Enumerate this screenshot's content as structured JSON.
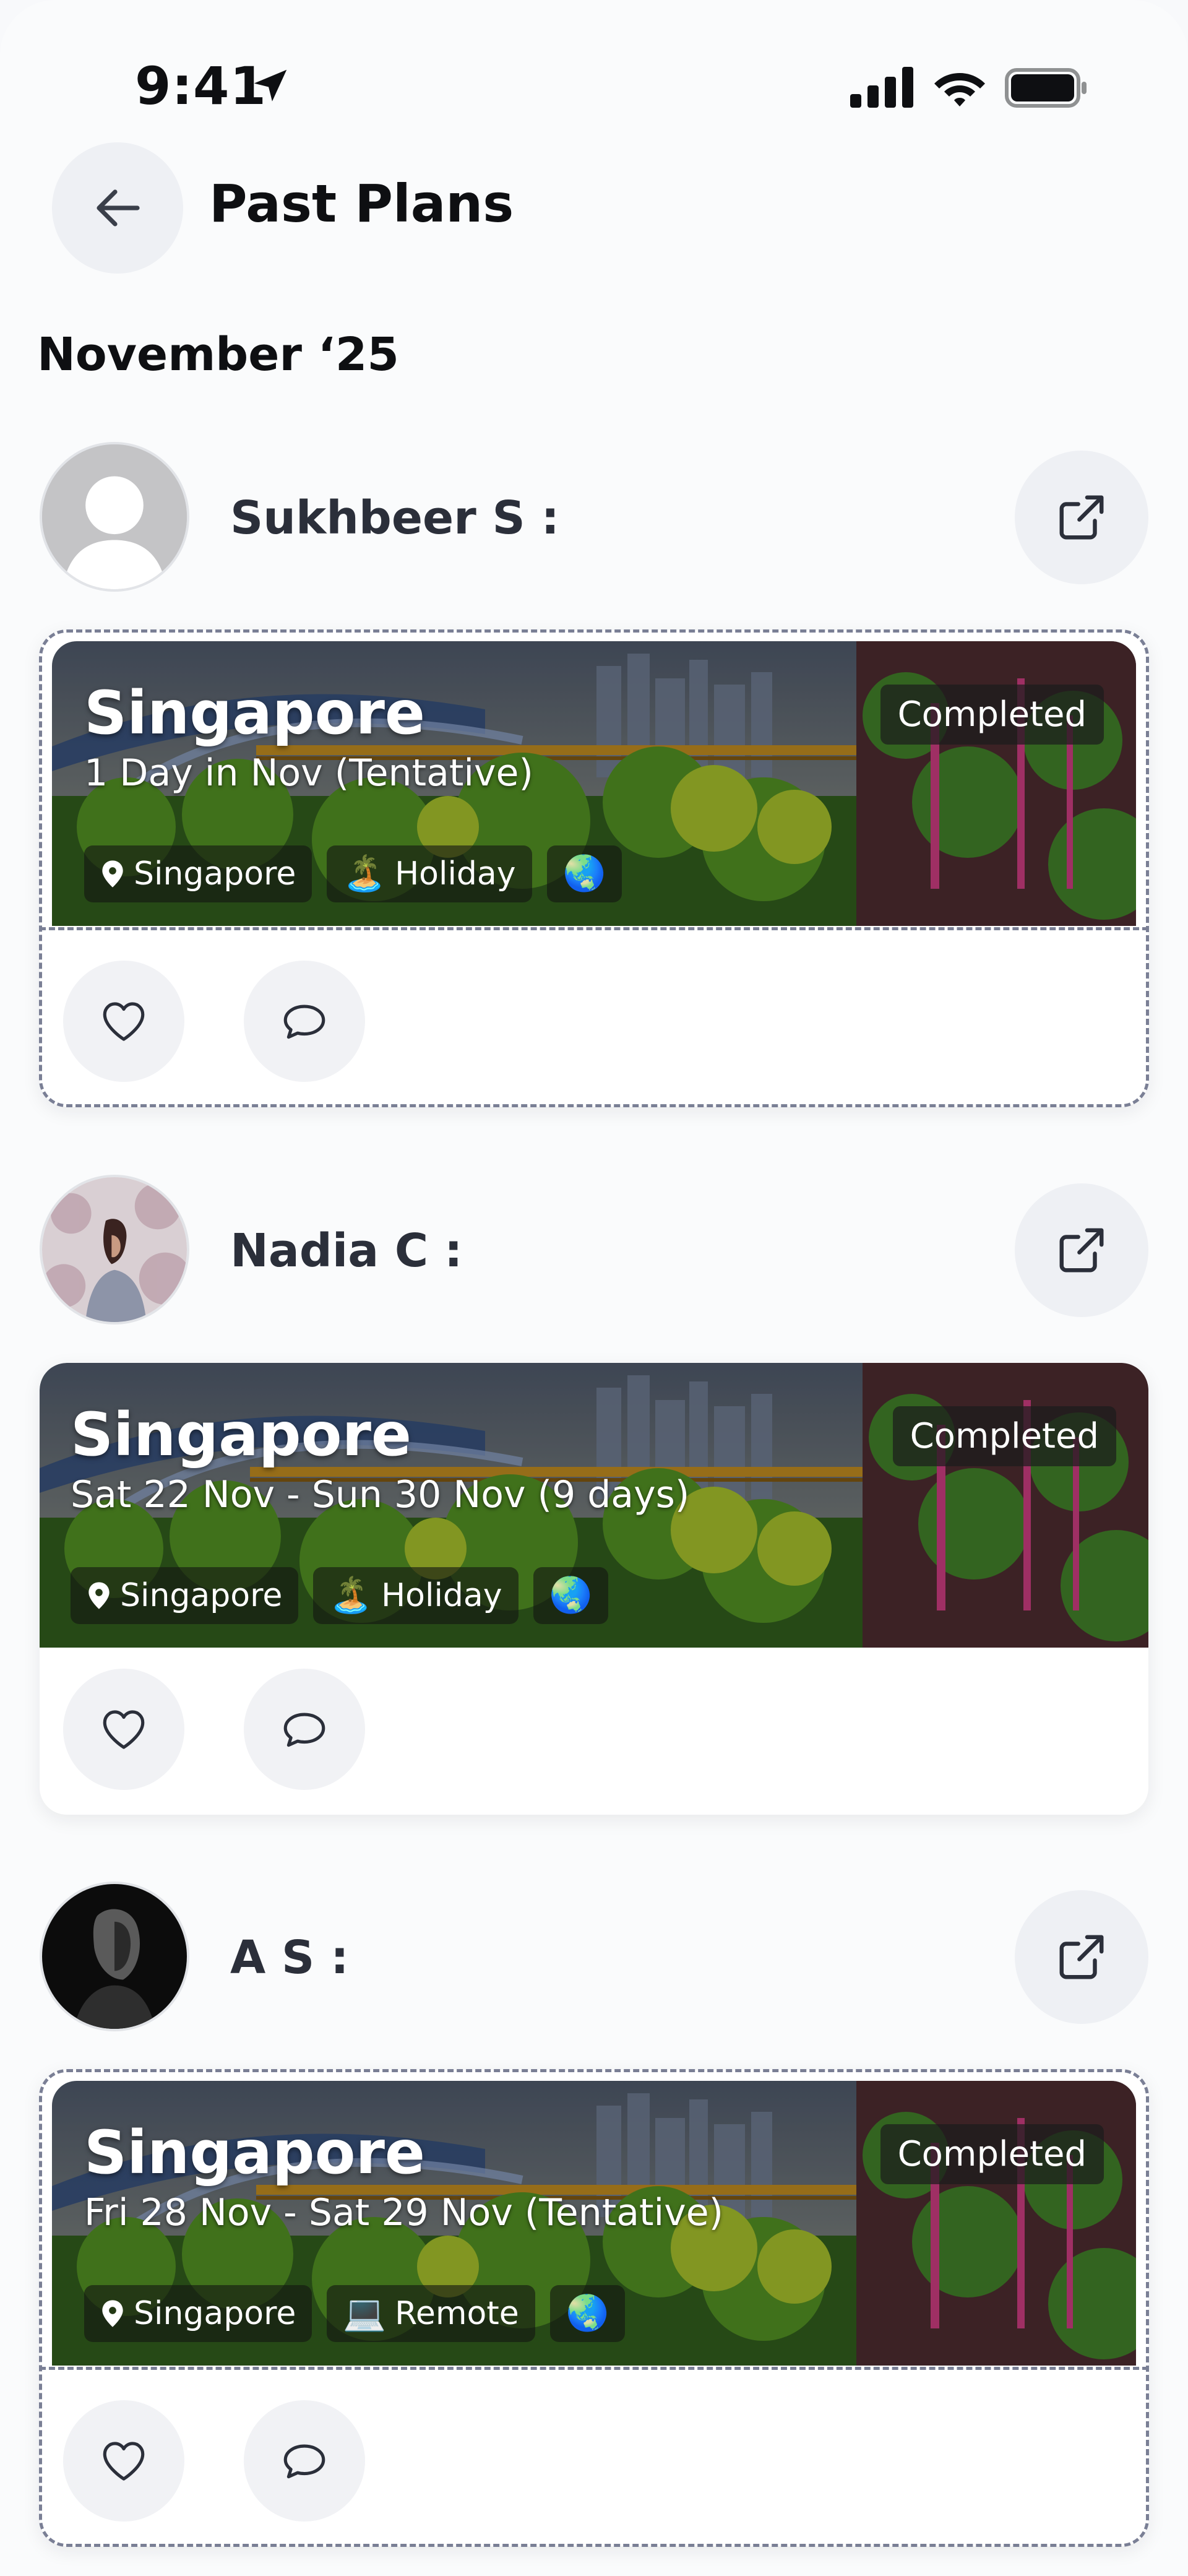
{
  "status_bar": {
    "time": "9:41"
  },
  "header": {
    "title": "Past Plans"
  },
  "month_heading": "November ‘25",
  "plans": [
    {
      "user": "Sukhbeer S :",
      "destination": "Singapore",
      "dates": "1 Day in Nov (Tentative)",
      "status": "Completed",
      "chips": [
        {
          "icon": "location-pin-icon",
          "label": "Singapore"
        },
        {
          "icon": "beach-island-emoji",
          "emoji": "🏝️",
          "label": "Holiday"
        },
        {
          "icon": "globe-emoji",
          "emoji": "🌏",
          "label": ""
        }
      ]
    },
    {
      "user": "Nadia C :",
      "destination": "Singapore",
      "dates": "Sat 22 Nov - Sun 30 Nov (9 days)",
      "status": "Completed",
      "chips": [
        {
          "icon": "location-pin-icon",
          "label": "Singapore"
        },
        {
          "icon": "beach-island-emoji",
          "emoji": "🏝️",
          "label": "Holiday"
        },
        {
          "icon": "globe-emoji",
          "emoji": "🌏",
          "label": ""
        }
      ]
    },
    {
      "user": "A S :",
      "destination": "Singapore",
      "dates": "Fri 28 Nov - Sat 29 Nov (Tentative)",
      "status": "Completed",
      "chips": [
        {
          "icon": "location-pin-icon",
          "label": "Singapore"
        },
        {
          "icon": "laptop-emoji",
          "emoji": "💻",
          "label": "Remote"
        },
        {
          "icon": "globe-emoji",
          "emoji": "🌏",
          "label": ""
        }
      ]
    }
  ]
}
